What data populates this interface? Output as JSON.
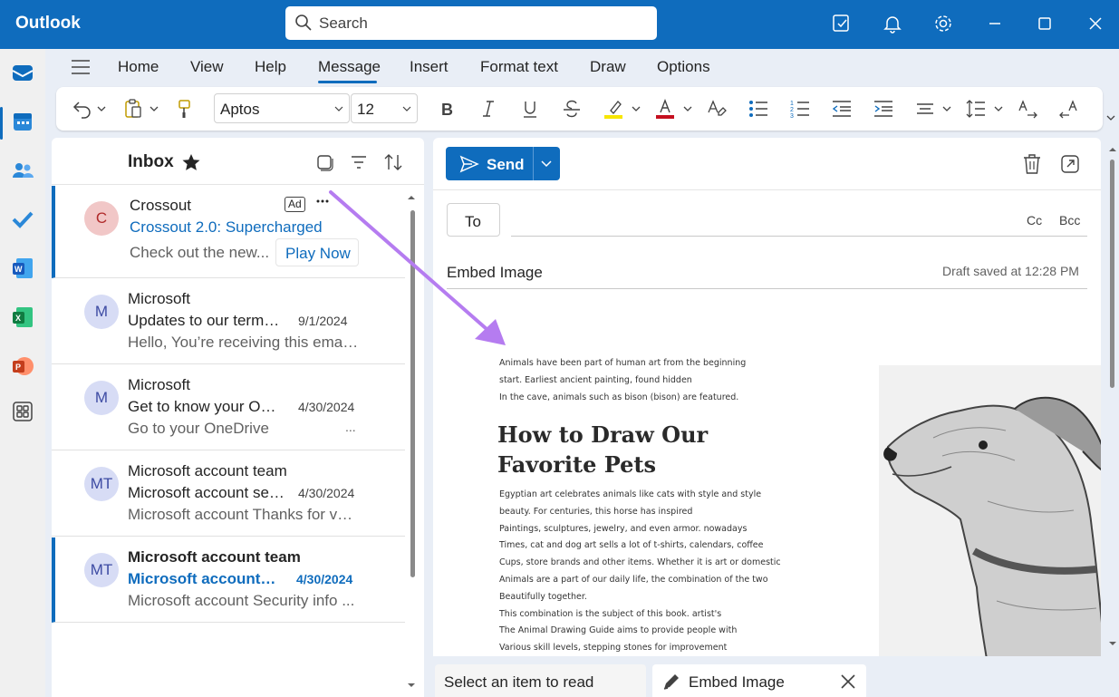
{
  "app": {
    "name": "Outlook",
    "search_placeholder": "Search"
  },
  "tabs": [
    "Home",
    "View",
    "Help",
    "Message",
    "Insert",
    "Format text",
    "Draw",
    "Options"
  ],
  "active_tab": "Message",
  "toolbar": {
    "font_name": "Aptos",
    "font_size": "12",
    "highlight_color": "#f7e600",
    "font_color": "#c50f1f"
  },
  "inbox": {
    "title": "Inbox",
    "items": [
      {
        "initials": "C",
        "sender": "Crossout",
        "subject": "Crossout 2.0: Supercharged",
        "preview": "Check out the new...",
        "ad_badge": "Ad",
        "cta": "Play Now"
      },
      {
        "initials": "M",
        "sender": "Microsoft",
        "subject": "Updates to our terms ...",
        "date": "9/1/2024",
        "preview": "Hello, You’re receiving this email ..."
      },
      {
        "initials": "M",
        "sender": "Microsoft",
        "subject": "Get to know your On...",
        "date": "4/30/2024",
        "preview": "Go to your OneDrive",
        "preview_suffix": "..."
      },
      {
        "initials": "MT",
        "sender": "Microsoft account team",
        "subject": "Microsoft account sec...",
        "date": "4/30/2024",
        "preview": "Microsoft account Thanks for ver..."
      },
      {
        "initials": "MT",
        "sender": "Microsoft account team",
        "subject": "Microsoft account s...",
        "date": "4/30/2024",
        "preview": "Microsoft account Security info ..."
      }
    ]
  },
  "compose": {
    "send_label": "Send",
    "to_label": "To",
    "cc_label": "Cc",
    "bcc_label": "Bcc",
    "subject": "Embed Image",
    "draft_status": "Draft saved at 12:28 PM",
    "embedded": {
      "intro_lines": [
        "Animals have been part of human art from the beginning",
        "start. Earliest ancient painting, found hidden",
        "In the cave, animals such as bison (bison) are featured."
      ],
      "title_line1": "How to Draw Our",
      "title_line2": "Favorite Pets",
      "body_lines": [
        "Egyptian art celebrates animals like cats with style and style",
        "beauty. For centuries, this horse has inspired",
        "Paintings, sculptures, jewelry, and even armor. nowadays",
        "Times, cat and dog art sells a lot of t-shirts, calendars, coffee",
        "Cups, store brands and other items. Whether it is art or domestic",
        "Animals are a part of our daily life, the combination of the two",
        "Beautifully together.",
        "This combination is the subject of this book. artist's",
        "The Animal Drawing Guide aims to provide people with",
        "Various skill levels, stepping stones for improvement"
      ]
    }
  },
  "bottom_tabs": {
    "read_label": "Select an item to read",
    "draft_label": "Embed Image"
  },
  "colors": {
    "brand": "#0f6cbd",
    "annotation_arrow": "#b57cf0"
  }
}
